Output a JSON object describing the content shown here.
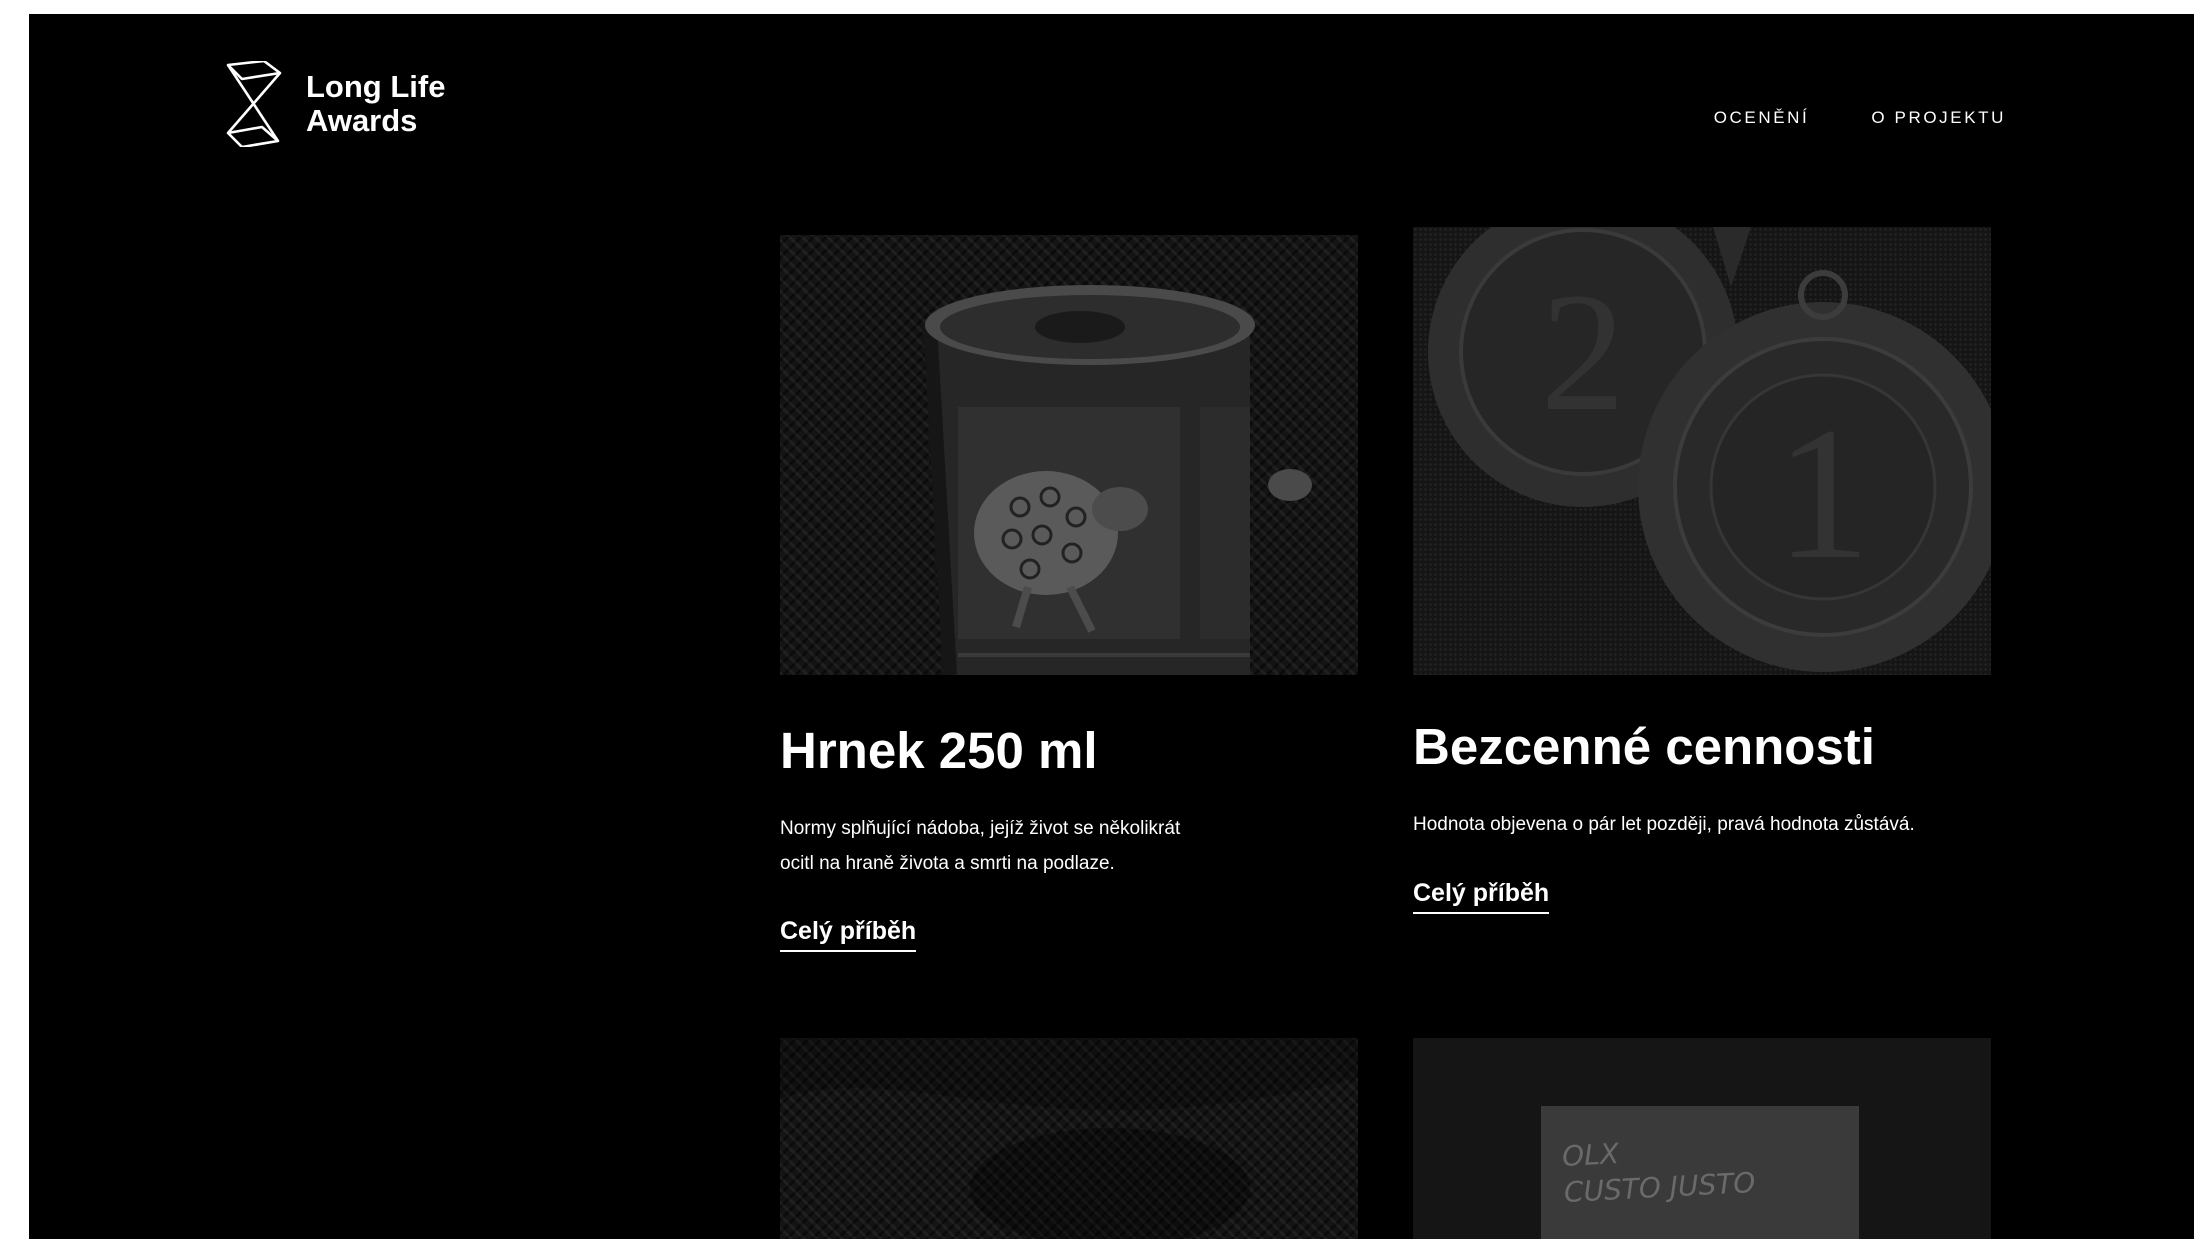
{
  "brand": {
    "line1": "Long Life",
    "line2": "Awards"
  },
  "nav": {
    "items": [
      {
        "label": "OCENĚNÍ"
      },
      {
        "label": "O PROJEKTU"
      }
    ]
  },
  "cards": [
    {
      "title": "Hrnek 250 ml",
      "description_line1": "Normy splňující nádoba, jejíž život se několikrát",
      "description_line2": "ocitl na hraně života a smrti na podlaze.",
      "link_label": "Celý příběh",
      "image": "mug-with-sheep-photo"
    },
    {
      "title": "Bezcenné cennosti",
      "description_line1": "Hodnota objevena o pár let později, pravá hodnota zůstává.",
      "link_label": "Celý příběh",
      "image": "medals-photo",
      "medal_numbers": [
        "2",
        "1"
      ]
    }
  ],
  "lower_cards": [
    {
      "image": "fabric-photo"
    },
    {
      "image": "handwritten-note-photo",
      "note_line1": "OLX",
      "note_line2": "CUSTO JUSTO"
    }
  ]
}
